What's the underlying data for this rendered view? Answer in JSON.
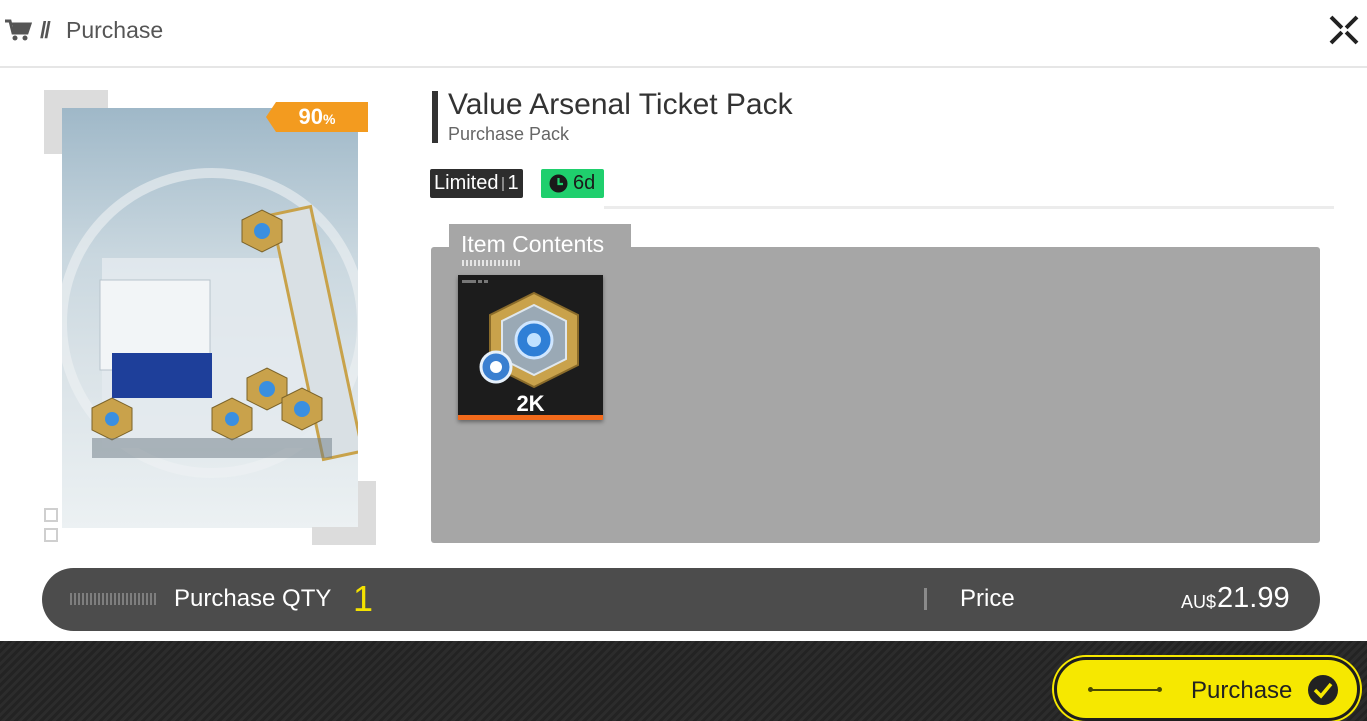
{
  "header": {
    "slash": "//",
    "title": "Purchase"
  },
  "pack": {
    "discount_value": "90",
    "discount_unit": "%",
    "title": "Value Arsenal Ticket Pack",
    "subtitle": "Purchase Pack",
    "limited_label": "Limited",
    "limited_count": "1",
    "time_left": "6d"
  },
  "contents": {
    "label": "Item Contents",
    "items": [
      {
        "icon": "arsenal-ticket-icon",
        "quantity": "2K"
      }
    ]
  },
  "purchase_bar": {
    "qty_label": "Purchase QTY",
    "qty_value": "1",
    "price_label": "Price",
    "currency": "AU$",
    "price": "21.99"
  },
  "footer": {
    "purchase_button": "Purchase"
  },
  "colors": {
    "discount": "#f39b1f",
    "timer": "#1fcf6d",
    "accent_yellow": "#f6e800",
    "bar": "#4c4c4c",
    "panel": "#a6a6a6",
    "item_rarity": "#f26a1b"
  }
}
